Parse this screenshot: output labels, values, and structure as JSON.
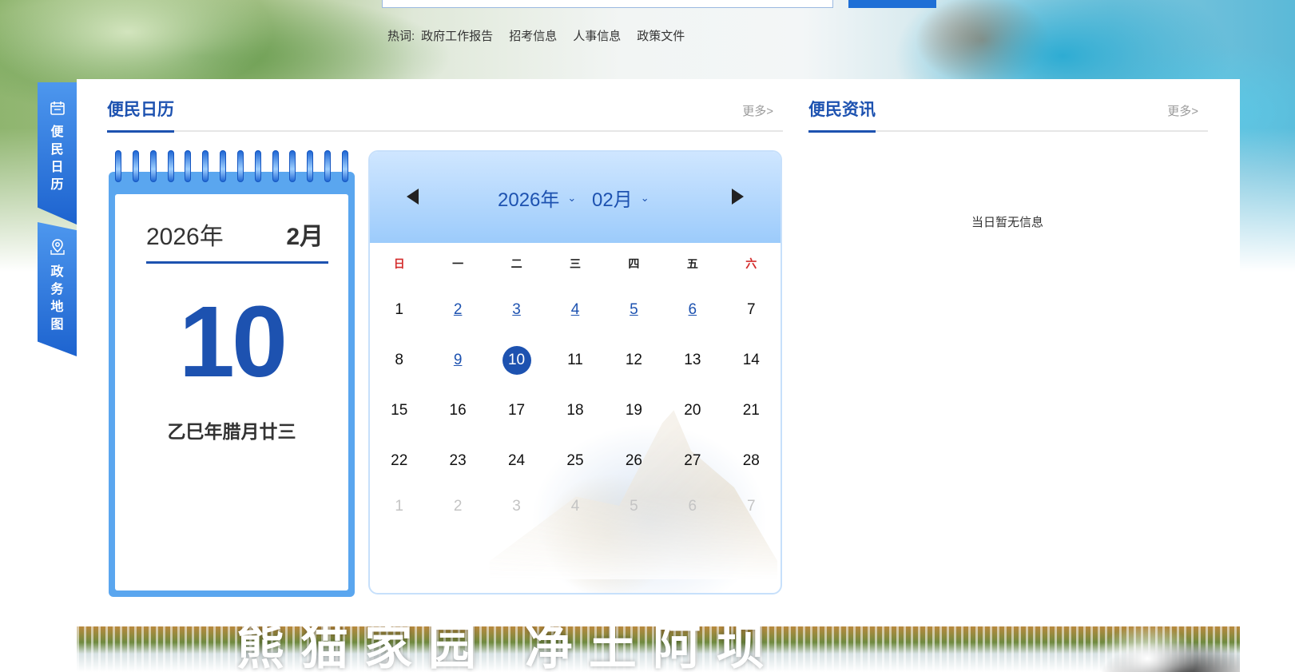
{
  "hotwords": {
    "label": "热词:",
    "items": [
      "政府工作报告",
      "招考信息",
      "人事信息",
      "政策文件"
    ]
  },
  "side_tabs": [
    {
      "icon": "calendar-icon",
      "chars": [
        "便",
        "民",
        "日",
        "历"
      ]
    },
    {
      "icon": "map-pin-icon",
      "chars": [
        "政",
        "务",
        "地",
        "图"
      ]
    }
  ],
  "calendar_section": {
    "title": "便民日历",
    "more": "更多>"
  },
  "info_section": {
    "title": "便民资讯",
    "more": "更多>",
    "empty_text": "当日暂无信息"
  },
  "desk_calendar": {
    "year": "2026年",
    "month": "2月",
    "day": "10",
    "lunar": "乙巳年腊月廿三"
  },
  "month_calendar": {
    "year_select": "2026年",
    "month_select": "02月",
    "weekdays": [
      "日",
      "一",
      "二",
      "三",
      "四",
      "五",
      "六"
    ],
    "weeks": [
      [
        {
          "d": "1",
          "s": "normal"
        },
        {
          "d": "2",
          "s": "link"
        },
        {
          "d": "3",
          "s": "link"
        },
        {
          "d": "4",
          "s": "link"
        },
        {
          "d": "5",
          "s": "link"
        },
        {
          "d": "6",
          "s": "link"
        },
        {
          "d": "7",
          "s": "normal"
        }
      ],
      [
        {
          "d": "8",
          "s": "normal"
        },
        {
          "d": "9",
          "s": "link"
        },
        {
          "d": "10",
          "s": "today"
        },
        {
          "d": "11",
          "s": "normal"
        },
        {
          "d": "12",
          "s": "normal"
        },
        {
          "d": "13",
          "s": "normal"
        },
        {
          "d": "14",
          "s": "normal"
        }
      ],
      [
        {
          "d": "15",
          "s": "normal"
        },
        {
          "d": "16",
          "s": "normal"
        },
        {
          "d": "17",
          "s": "normal"
        },
        {
          "d": "18",
          "s": "normal"
        },
        {
          "d": "19",
          "s": "normal"
        },
        {
          "d": "20",
          "s": "normal"
        },
        {
          "d": "21",
          "s": "normal"
        }
      ],
      [
        {
          "d": "22",
          "s": "normal"
        },
        {
          "d": "23",
          "s": "normal"
        },
        {
          "d": "24",
          "s": "normal"
        },
        {
          "d": "25",
          "s": "normal"
        },
        {
          "d": "26",
          "s": "normal"
        },
        {
          "d": "27",
          "s": "normal"
        },
        {
          "d": "28",
          "s": "normal"
        }
      ],
      [
        {
          "d": "1",
          "s": "muted"
        },
        {
          "d": "2",
          "s": "muted"
        },
        {
          "d": "3",
          "s": "muted"
        },
        {
          "d": "4",
          "s": "muted"
        },
        {
          "d": "5",
          "s": "muted"
        },
        {
          "d": "6",
          "s": "muted"
        },
        {
          "d": "7",
          "s": "muted"
        }
      ]
    ]
  },
  "bottom_banner": {
    "text": "熊猫家园 净土阿坝"
  },
  "colors": {
    "accent": "#1d52b0",
    "side_tab": "#1d63cf",
    "weekend_red": "#d42c2c",
    "muted": "#c4c4c4"
  }
}
